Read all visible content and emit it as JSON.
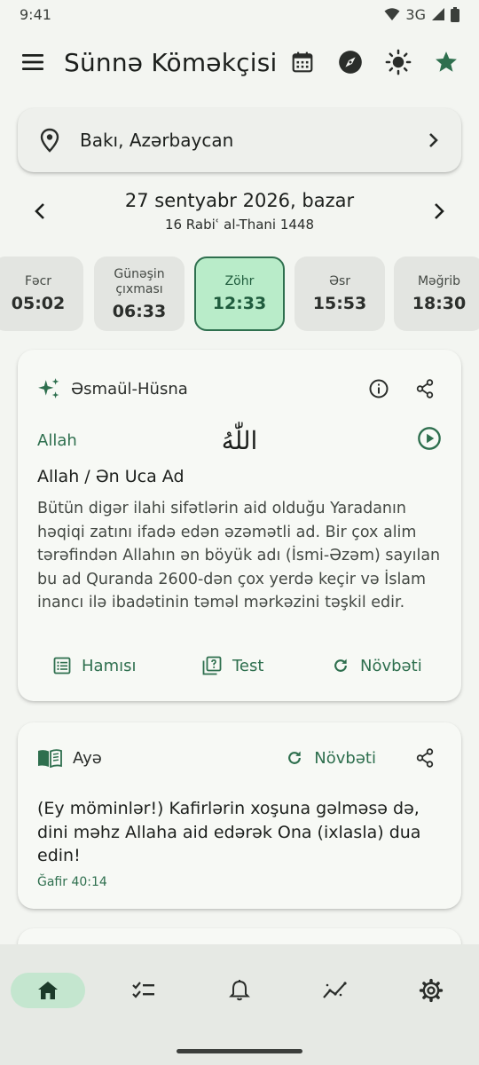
{
  "status_bar": {
    "time": "9:41",
    "network": "3G"
  },
  "app_bar": {
    "title": "Sünnə Köməkçisi",
    "actions": [
      "calendar-icon",
      "compass-icon",
      "brightness-icon",
      "star-icon"
    ]
  },
  "location": {
    "text": "Bakı, Azərbaycan"
  },
  "date": {
    "gregorian": "27 sentyabr 2026, bazar",
    "hijri": "16 Rabiʿ al-Thani 1448"
  },
  "prayers": [
    {
      "name": "Fəcr",
      "time": "05:02"
    },
    {
      "name": "Günəşin çıxması",
      "time": "06:33"
    },
    {
      "name": "Zöhr",
      "time": "12:33",
      "active": true
    },
    {
      "name": "Əsr",
      "time": "15:53"
    },
    {
      "name": "Məğrib",
      "time": "18:30"
    }
  ],
  "names_card": {
    "title": "Əsmaül-Hüsna",
    "transliteration": "Allah",
    "arabic": "اللّٰهُ",
    "meaning": "Allah / Ən Uca Ad",
    "description": "Bütün digər ilahi sifətlərin aid olduğu Yaradanın həqiqi zatını ifadə edən əzəmətli ad. Bir çox alim tərəfindən Allahın ən böyük adı (İsmi-Əzəm) sayılan bu ad Quranda 2600-dən çox yerdə keçir və İslam inancı ilə ibadətinin təməl mərkəzini təşkil edir.",
    "actions": {
      "all": "Hamısı",
      "test": "Test",
      "next": "Növbəti"
    }
  },
  "ayah_card": {
    "title": "Ayə",
    "next": "Növbəti",
    "text": "(Ey möminlər!) Kafirlərin xoşuna gəlməsə də, dini məhz Allaha aid edərək Ona (ixlasla) dua edin!",
    "reference": "Ğafir 40:14"
  },
  "bottom_nav": {
    "items": [
      "home-icon",
      "checklist-icon",
      "bell-icon",
      "chart-icon",
      "settings-icon"
    ],
    "active_index": 0
  },
  "colors": {
    "accent": "#2e6f4e",
    "active_chip": "#b9ecc9",
    "background": "#f3f5f1"
  }
}
